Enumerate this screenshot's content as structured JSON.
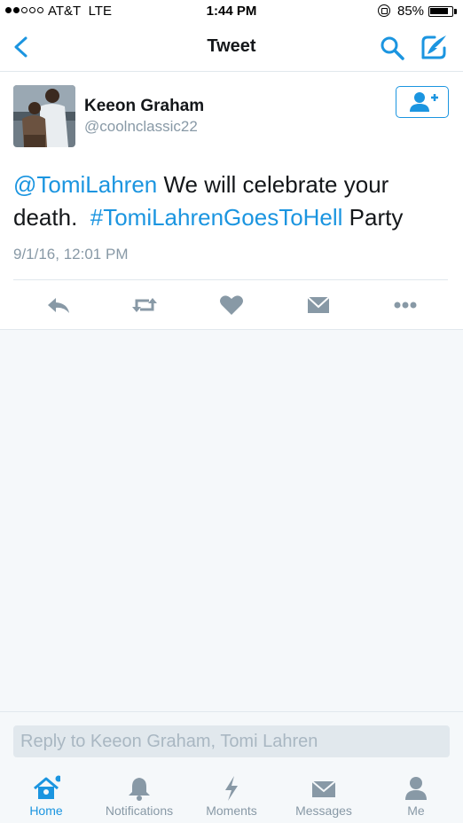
{
  "status_bar": {
    "carrier": "AT&T",
    "network": "LTE",
    "time": "1:44 PM",
    "battery_percent": "85%",
    "battery_level": 0.85,
    "signal_bars_filled": 2,
    "signal_bars_total": 5
  },
  "nav": {
    "title": "Tweet",
    "back_icon": "chevron-left-icon",
    "search_icon": "search-icon",
    "compose_icon": "compose-icon"
  },
  "tweet": {
    "user_name": "Keeon Graham",
    "user_handle": "@coolnclassic22",
    "text_mention": "@TomiLahren",
    "text_part1": " We will celebrate your death.  ",
    "text_hashtag": "#TomiLahrenGoesToHell",
    "text_part2": " Party",
    "timestamp": "9/1/16, 12:01 PM",
    "actions": [
      "reply-icon",
      "retweet-icon",
      "like-icon",
      "direct-message-icon",
      "more-icon"
    ]
  },
  "reply": {
    "placeholder": "Reply to Keeon Graham, Tomi Lahren"
  },
  "tabs": [
    {
      "label": "Home",
      "icon": "home-icon",
      "active": true
    },
    {
      "label": "Notifications",
      "icon": "bell-icon",
      "active": false
    },
    {
      "label": "Moments",
      "icon": "lightning-icon",
      "active": false
    },
    {
      "label": "Messages",
      "icon": "envelope-icon",
      "active": false
    },
    {
      "label": "Me",
      "icon": "person-icon",
      "active": false
    }
  ],
  "colors": {
    "accent": "#1b95e0",
    "secondary_text": "#8899a6",
    "background": "#f5f8fa"
  }
}
